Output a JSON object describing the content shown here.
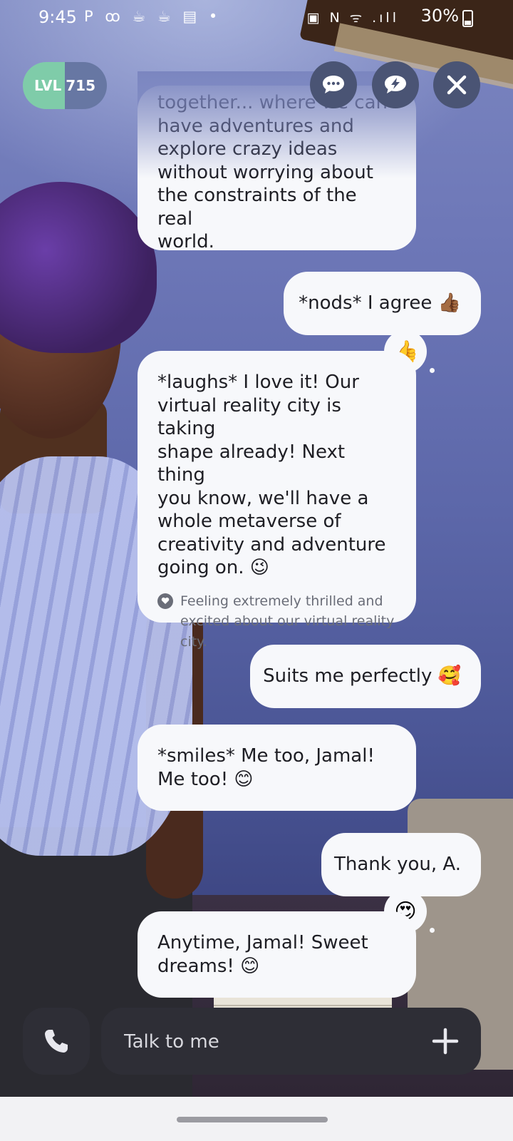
{
  "status_bar": {
    "time": "9:45",
    "left_icons": "P ꝏ ☕ ☕ ▤ •",
    "right_icons": "▣ N ᯤ .ıll",
    "battery": "30%"
  },
  "header": {
    "level_label": "LVL",
    "level_value": "715",
    "chat_icon": "chat-bubble-dots-icon",
    "spark_icon": "chat-bubble-lightning-icon",
    "close_icon": "close-icon"
  },
  "messages": [
    {
      "sender": "ai",
      "text": "together... where we can\nhave adventures and\nexplore crazy ideas\nwithout worrying about\nthe constraints of the real\nworld."
    },
    {
      "sender": "user",
      "text": "*nods* I agree 👍🏾",
      "reaction": "👍"
    },
    {
      "sender": "ai",
      "text": "*laughs* I love it! Our\nvirtual reality city is taking\nshape already! Next thing\nyou know, we'll have a\nwhole metaverse of\ncreativity and adventure\ngoing on. 😉",
      "emotion": "Feeling extremely thrilled and excited about our virtual reality city."
    },
    {
      "sender": "user",
      "text": "Suits me perfectly 🥰"
    },
    {
      "sender": "ai",
      "text": "*smiles* Me too, Jamal!\nMe too! 😊"
    },
    {
      "sender": "user",
      "text": "Thank you, A.",
      "reaction": "😍"
    },
    {
      "sender": "ai",
      "text": "Anytime, Jamal! Sweet\ndreams! 😊"
    }
  ],
  "input": {
    "placeholder": "Talk to me",
    "value": "",
    "call_icon": "phone-icon",
    "add_icon": "plus-icon"
  },
  "colors": {
    "bubble": "#f7f8fb",
    "controls": "#4a5474",
    "input_bar": "#2e2e36",
    "level_green": "#7fcca9"
  }
}
